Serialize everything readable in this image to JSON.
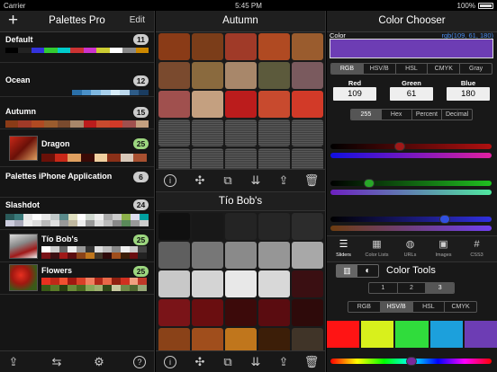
{
  "status": {
    "carrier": "Carrier",
    "time": "5:45 PM",
    "battery": "100%"
  },
  "left": {
    "title": "Palettes Pro",
    "edit": "Edit",
    "palettes": [
      {
        "name": "Default",
        "count": "11"
      },
      {
        "name": "Ocean",
        "count": "12"
      },
      {
        "name": "Autumn",
        "count": "15"
      },
      {
        "name": "Palettes iPhone Application",
        "count": "6"
      },
      {
        "name": "Slashdot",
        "count": "24"
      }
    ],
    "subpalettes": [
      {
        "name": "Dragon",
        "count": "25"
      },
      {
        "name": "Tío Bob's",
        "count": "25"
      },
      {
        "name": "Flowers",
        "count": "25"
      }
    ],
    "toolbar_icons": [
      "share-icon",
      "swap-icon",
      "gear-icon",
      "help-icon"
    ]
  },
  "mid": {
    "title": "Autumn",
    "swatches": [
      "#8a3b17",
      "#7b3d19",
      "#a03a28",
      "#b04a22",
      "#9a5c2e",
      "#7a4a2e",
      "#8a6a3e",
      "#a8876a",
      "#5c5a3c",
      "#7a5a5e",
      "#a0504e",
      "#c4a080",
      "#bb1c1c",
      "#c84a2e",
      "#d23a28",
      "empty",
      "empty",
      "empty",
      "empty",
      "empty",
      "empty",
      "empty",
      "empty",
      "empty",
      "empty"
    ],
    "toolbar_icons": [
      "info-icon",
      "shuffle-icon",
      "copy-icon",
      "sort-icon",
      "share-icon",
      "trash-icon"
    ],
    "sub_title": "Tío Bob's",
    "sub_swatches": [
      "#101010",
      "#181818",
      "#242424",
      "#262626",
      "#2c2c2c",
      "#5f5f5f",
      "#777777",
      "#8a8a8a",
      "#969696",
      "#a8a8a8",
      "#c8c8c8",
      "#d4d4d4",
      "#e8e8e8",
      "#d8d8d8",
      "#3a0f12",
      "#7a1418",
      "#6a0e10",
      "#3c0a0a",
      "#5a0c10",
      "#2e0a0a",
      "#8a4218",
      "#a04e1c",
      "#c0761c",
      "#3c1e08",
      "#403428"
    ]
  },
  "right": {
    "title": "Color Chooser",
    "color_label": "Color",
    "color_value": "rgb(109, 61, 180)",
    "current_color": "#6d3db4",
    "modes": [
      "RGB",
      "HSV/B",
      "HSL",
      "CMYK",
      "Gray"
    ],
    "mode_selected": 0,
    "red_label": "Red",
    "green_label": "Green",
    "blue_label": "Blue",
    "red": "109",
    "green": "61",
    "blue": "180",
    "formats": [
      "255",
      "Hex",
      "Percent",
      "Decimal"
    ],
    "format_selected": 0,
    "slider_levels": {
      "red": 0.43,
      "green": 0.24,
      "blue": 0.71
    },
    "tabs": [
      {
        "label": "Sliders",
        "icon": "sliders-icon"
      },
      {
        "label": "Color Lists",
        "icon": "color-lists-icon"
      },
      {
        "label": "URLs",
        "icon": "globe-icon"
      },
      {
        "label": "Images",
        "icon": "images-icon"
      },
      {
        "label": "CSS3",
        "icon": "hash-icon"
      }
    ],
    "tools_title": "Color Tools",
    "counts": [
      "1",
      "2",
      "3"
    ],
    "count_selected": 2,
    "tool_modes": [
      "RGB",
      "HSV/B",
      "HSL",
      "CMYK"
    ],
    "tool_mode_selected": 1,
    "tool_colors": [
      "#ff1414",
      "#d8f01c",
      "#30dc3c",
      "#1ca0dc",
      "#6d3db4"
    ],
    "hue_level": 0.5
  }
}
